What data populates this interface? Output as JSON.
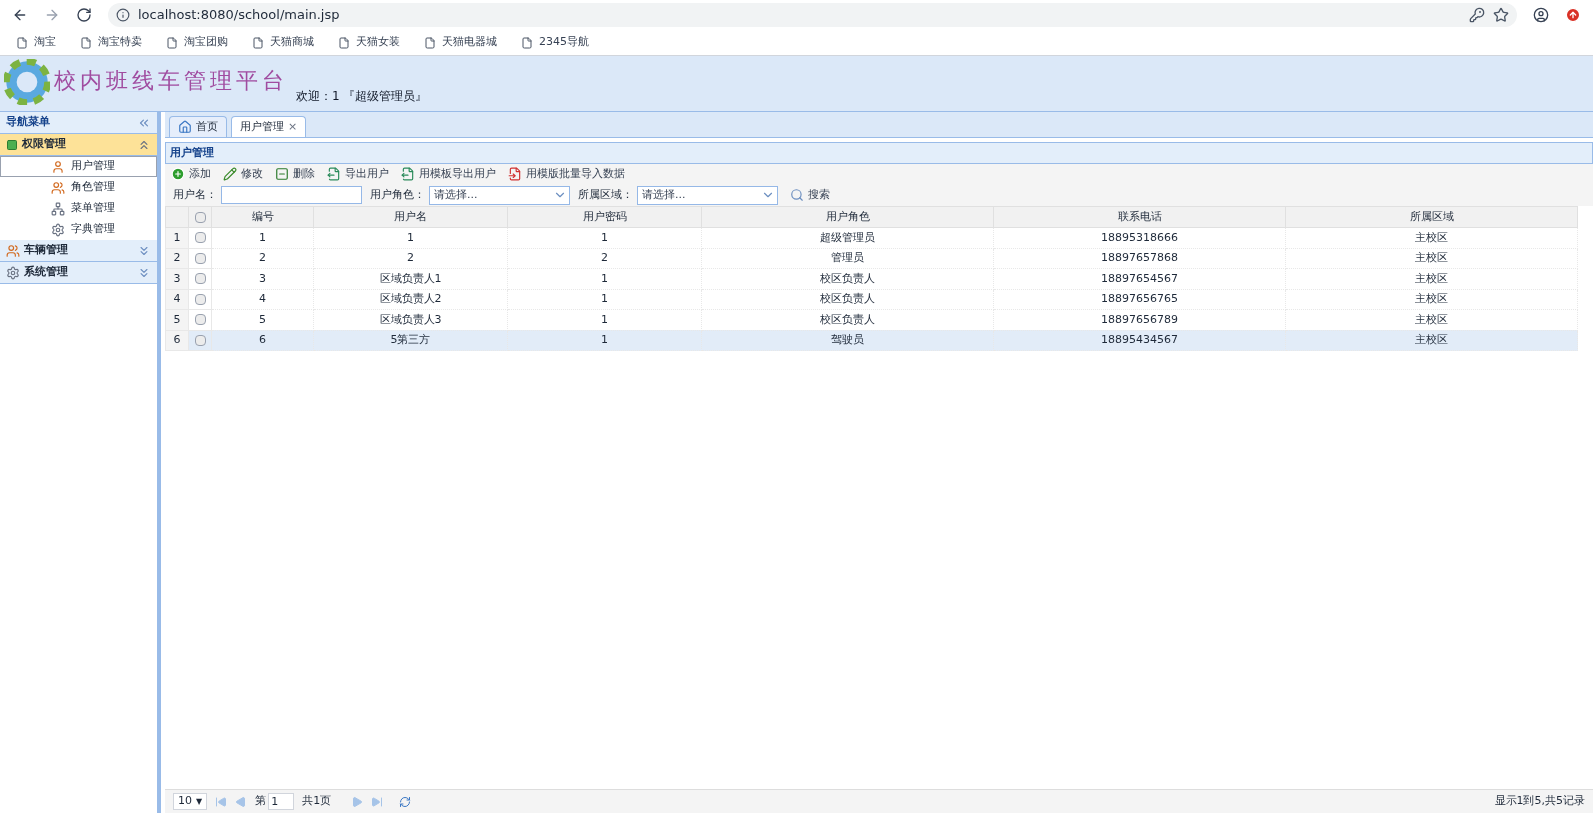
{
  "browser": {
    "url": "localhost:8080/school/main.jsp",
    "bookmarks": [
      "淘宝",
      "淘宝特卖",
      "淘宝团购",
      "天猫商城",
      "天猫女装",
      "天猫电器城",
      "2345导航"
    ]
  },
  "header": {
    "title": "校内班线车管理平台",
    "welcome": "欢迎：1 『超级管理员』"
  },
  "sidebar": {
    "title": "导航菜单",
    "groups": [
      {
        "label": "权限管理",
        "expanded": true,
        "kind": "key",
        "children": [
          {
            "label": "用户管理",
            "selected": true,
            "kind": "user"
          },
          {
            "label": "角色管理",
            "selected": false,
            "kind": "users"
          },
          {
            "label": "菜单管理",
            "selected": false,
            "kind": "tree"
          },
          {
            "label": "字典管理",
            "selected": false,
            "kind": "gear"
          }
        ]
      },
      {
        "label": "车辆管理",
        "expanded": false,
        "kind": "users"
      },
      {
        "label": "系统管理",
        "expanded": false,
        "kind": "gear"
      }
    ]
  },
  "tabs": [
    {
      "label": "首页",
      "selected": false
    },
    {
      "label": "用户管理",
      "selected": true,
      "close": "×"
    }
  ],
  "panel": {
    "title": "用户管理",
    "toolbar": [
      {
        "label": "添加",
        "kind": "add"
      },
      {
        "label": "修改",
        "kind": "edit"
      },
      {
        "label": "删除",
        "kind": "remove"
      },
      {
        "label": "导出用户",
        "kind": "export"
      },
      {
        "label": "用模板导出用户",
        "kind": "export"
      },
      {
        "label": "用模版批量导入数据",
        "kind": "import"
      }
    ],
    "filters": [
      {
        "label": "用户名：",
        "kind": "text"
      },
      {
        "label": "用户角色：",
        "kind": "select",
        "placeholder": "请选择..."
      },
      {
        "label": "所属区域：",
        "kind": "select",
        "placeholder": "请选择..."
      }
    ],
    "search": "搜索",
    "table": {
      "all_checked": false,
      "columns": [
        "编号",
        "用户名",
        "用户密码",
        "用户角色",
        "联系电话",
        "所属区域"
      ],
      "rows": [
        {
          "num": "1",
          "selected": false,
          "cells": [
            "1",
            "1",
            "1",
            "超级管理员",
            "18895318666",
            "主校区"
          ]
        },
        {
          "num": "2",
          "selected": false,
          "cells": [
            "2",
            "2",
            "2",
            "管理员",
            "18897657868",
            "主校区"
          ]
        },
        {
          "num": "3",
          "selected": false,
          "cells": [
            "3",
            "区域负责人1",
            "1",
            "校区负责人",
            "18897654567",
            "主校区"
          ]
        },
        {
          "num": "4",
          "selected": false,
          "cells": [
            "4",
            "区域负责人2",
            "1",
            "校区负责人",
            "18897656765",
            "主校区"
          ]
        },
        {
          "num": "5",
          "selected": false,
          "cells": [
            "5",
            "区域负责人3",
            "1",
            "校区负责人",
            "18897656789",
            "主校区"
          ]
        },
        {
          "num": "6",
          "selected": true,
          "cells": [
            "6",
            "5第三方",
            "1",
            "驾驶员",
            "18895434567",
            "主校区"
          ]
        }
      ]
    },
    "pager": {
      "page_size": "10",
      "page_size_arrow": "▼",
      "page_label": "第",
      "page": "1",
      "total_pages": "共1页",
      "summary": "显示1到5,共5记录"
    }
  }
}
